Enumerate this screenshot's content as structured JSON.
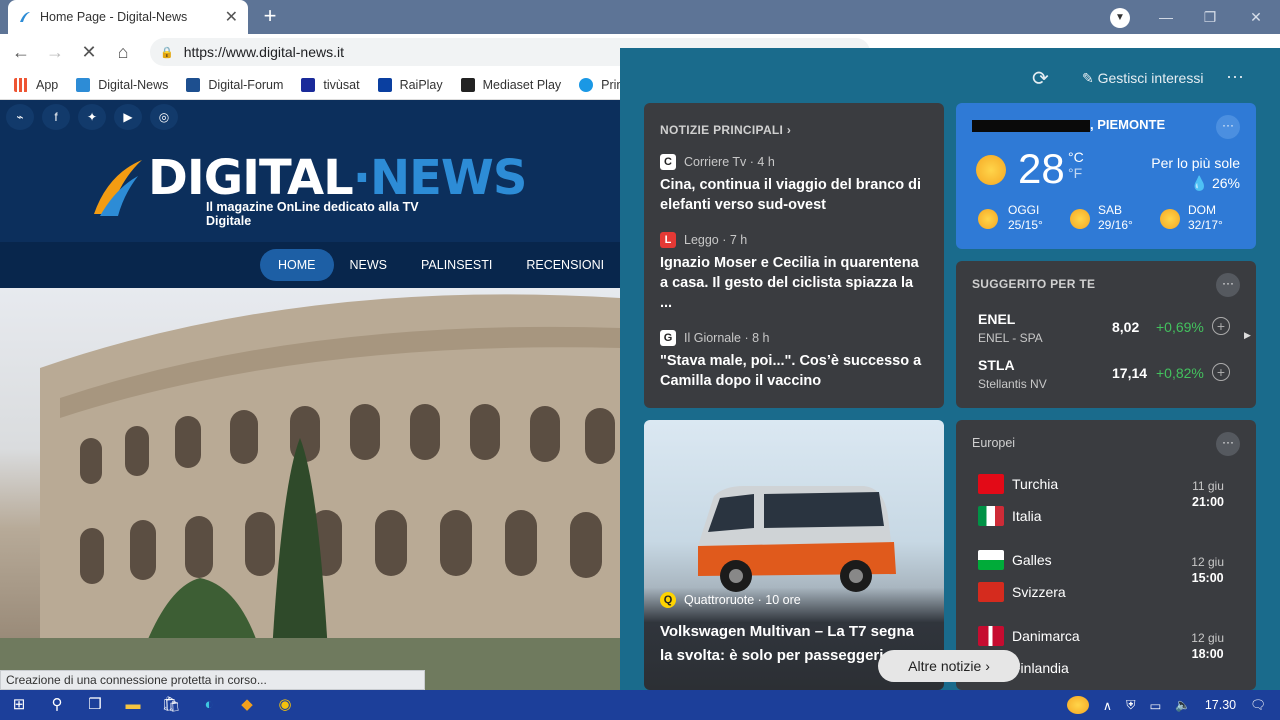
{
  "browser": {
    "tab_title": "Home Page - Digital-News",
    "url": "https://www.digital-news.it",
    "bookmarks": [
      "App",
      "Digital-News",
      "Digital-Forum",
      "tivùsat",
      "RaiPlay",
      "Mediaset Play",
      "Prime"
    ]
  },
  "site": {
    "brand_left": "DIGITAL",
    "brand_dot": "·",
    "brand_right": "NEWS",
    "tagline": "Il magazine OnLine dedicato alla TV Digitale",
    "nav": [
      "HOME",
      "NEWS",
      "PALINSESTI",
      "RECENSIONI"
    ],
    "status_text": "Creazione di una connessione protetta in corso..."
  },
  "panel": {
    "manage_label": "Gestisci interessi",
    "top_news": {
      "header": "NOTIZIE PRINCIPALI",
      "items": [
        {
          "source": "Corriere Tv · 4 h",
          "headline": "Cina, continua il viaggio del branco di elefanti verso sud-ovest"
        },
        {
          "source": "Leggo · 7 h",
          "headline": "Ignazio Moser e Cecilia in quarentena a casa. Il gesto del ciclista spiazza la ..."
        },
        {
          "source": "Il Giornale · 8 h",
          "headline": "\"Stava male, poi...\". Cos’è successo a Camilla dopo il vaccino"
        }
      ]
    },
    "weather": {
      "region": ", PIEMONTE",
      "temp": "28",
      "unit_c": "°C",
      "unit_f": "°F",
      "condition": "Per lo più sole",
      "rain": "26%",
      "forecast": [
        {
          "day": "OGGI",
          "range": "25/15°"
        },
        {
          "day": "SAB",
          "range": "29/16°"
        },
        {
          "day": "DOM",
          "range": "32/17°"
        }
      ]
    },
    "stocks": {
      "header": "SUGGERITO PER TE",
      "items": [
        {
          "symbol": "ENEL",
          "name": "ENEL - SPA",
          "value": "8,02",
          "change": "+0,69%"
        },
        {
          "symbol": "STLA",
          "name": "Stellantis NV",
          "value": "17,14",
          "change": "+0,82%"
        }
      ]
    },
    "car_story": {
      "source": "Quattroruote · 10 ore",
      "headline": "Volkswagen Multivan – La T7 segna la svolta: è solo per passeggeri"
    },
    "europei": {
      "header": "Europei",
      "matches": [
        {
          "team1": "Turchia",
          "team2": "Italia",
          "date": "11 giu",
          "time": "21:00"
        },
        {
          "team1": "Galles",
          "team2": "Svizzera",
          "date": "12 giu",
          "time": "15:00"
        },
        {
          "team1": "Danimarca",
          "team2": "Finlandia",
          "date": "12 giu",
          "time": "18:00"
        }
      ]
    },
    "more_news": "Altre notizie"
  },
  "taskbar": {
    "time": "17.30"
  }
}
